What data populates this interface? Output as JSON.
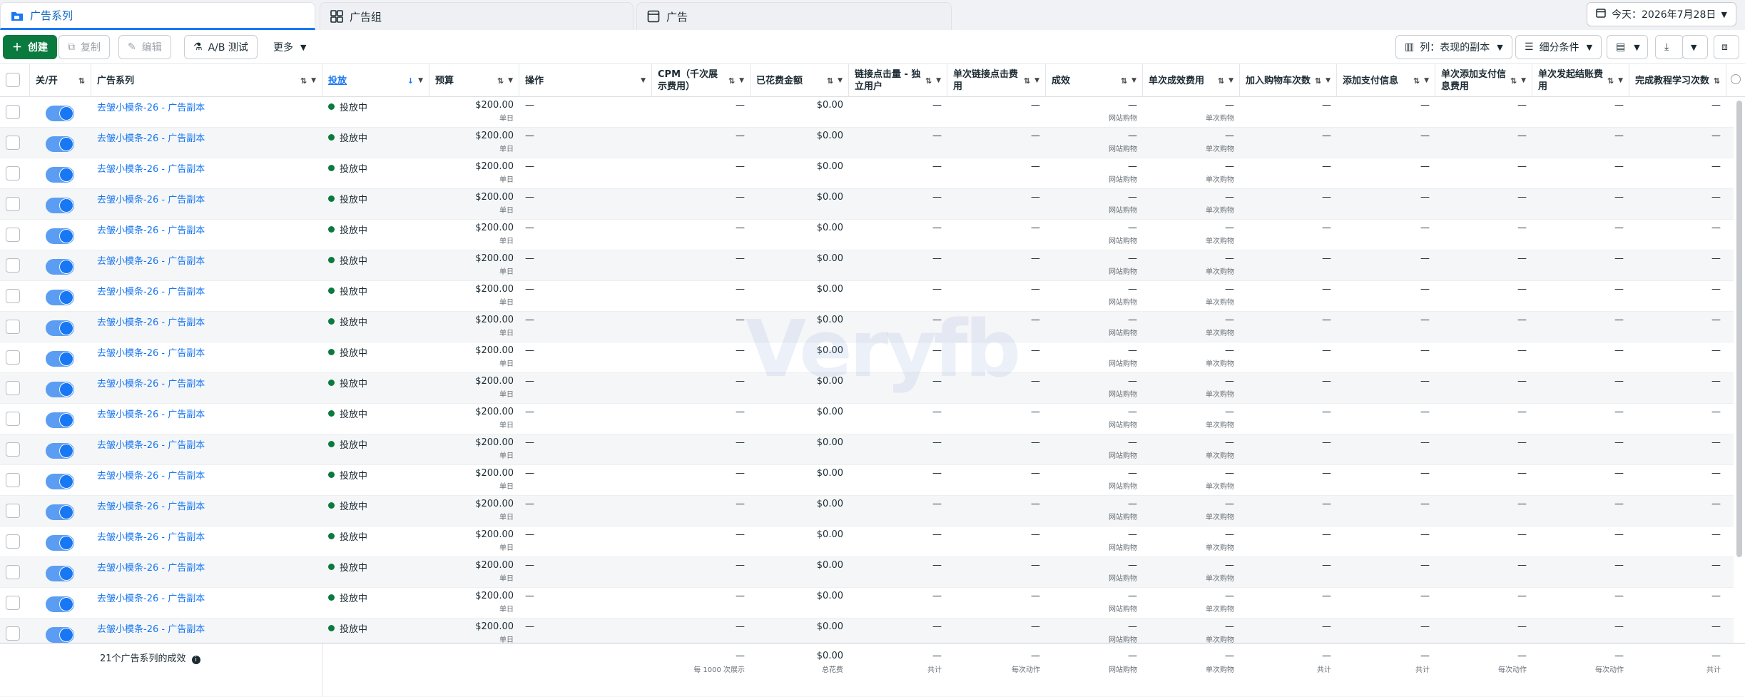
{
  "tabs": [
    {
      "label": "广告系列",
      "icon": "folder-icon",
      "active": true
    },
    {
      "label": "广告组",
      "icon": "grid-icon",
      "active": false
    },
    {
      "label": "广告",
      "icon": "ad-icon",
      "active": false
    }
  ],
  "date_button": {
    "label": "今天：2026年7月28日",
    "icon": "calendar-icon"
  },
  "toolbar": {
    "create": "创建",
    "duplicate": "复制",
    "edit": "编辑",
    "ab_test": "A/B 测试",
    "more": "更多",
    "columns": "列：表现的副本",
    "breakdown": "细分条件"
  },
  "columns": [
    {
      "label": "关/开",
      "sort": "⇅"
    },
    {
      "label": "广告系列",
      "sort": "⇅"
    },
    {
      "label": "投放",
      "sort": "↓"
    },
    {
      "label": "预算",
      "sort": "⇅"
    },
    {
      "label": "操作",
      "sort": ""
    },
    {
      "label": "CPM（千次展示费用）",
      "sort": "⇅"
    },
    {
      "label": "已花费金额",
      "sort": "⇅"
    },
    {
      "label": "链接点击量 - 独立用户",
      "sort": "⇅"
    },
    {
      "label": "单次链接点击费用",
      "sort": "⇅"
    },
    {
      "label": "成效",
      "sort": "⇅"
    },
    {
      "label": "单次成效费用",
      "sort": "⇅"
    },
    {
      "label": "加入购物车次数",
      "sort": "⇅"
    },
    {
      "label": "添加支付信息",
      "sort": "⇅"
    },
    {
      "label": "单次添加支付信息费用",
      "sort": "⇅"
    },
    {
      "label": "单次发起结账费用",
      "sort": "⇅"
    },
    {
      "label": "完成教程学习次数",
      "sort": "⇅"
    }
  ],
  "row_template": {
    "name": "去皱小模条-26 - 广告副本",
    "status": "投放中",
    "budget": "$200.00",
    "budget_period": "单日",
    "dash": "—",
    "spent": "$0.00",
    "results_sub": "网站购物",
    "cost_sub": "单次购物"
  },
  "row_count": 18,
  "footer": {
    "summary": "21个广告系列的成效",
    "info_icon": "info-icon",
    "cpm_sub": "每 1000 次展示",
    "spent": "$0.00",
    "spent_sub": "总花费",
    "link_sub": "共计",
    "cplc_sub": "每次动作",
    "results_sub": "网站购物",
    "cpr_sub": "单次购物",
    "cart_sub": "共计",
    "payinfo_sub": "共计",
    "cpp_sub": "每次动作",
    "checkout_sub": "每次动作",
    "tutorial_sub": "共计"
  },
  "watermark": "Veryfb"
}
